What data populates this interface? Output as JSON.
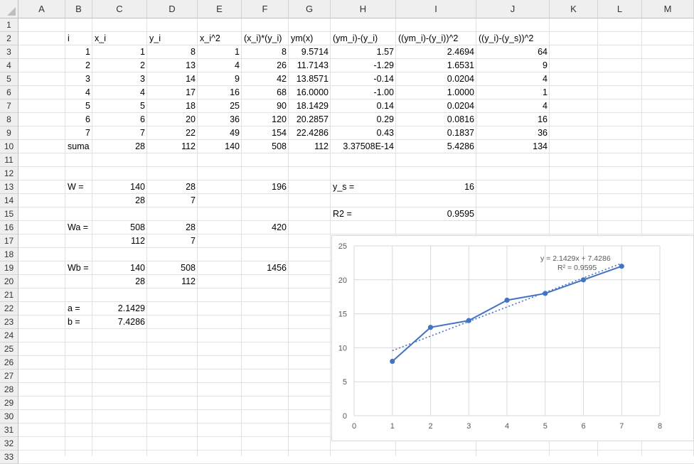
{
  "columns": [
    "A",
    "B",
    "C",
    "D",
    "E",
    "F",
    "G",
    "H",
    "I",
    "J",
    "K",
    "L",
    "M"
  ],
  "rows": [
    "1",
    "2",
    "3",
    "4",
    "5",
    "6",
    "7",
    "8",
    "9",
    "10",
    "11",
    "12",
    "13",
    "14",
    "15",
    "16",
    "17",
    "18",
    "19",
    "20",
    "21",
    "22",
    "23",
    "24",
    "25",
    "26",
    "27",
    "28",
    "29",
    "30",
    "31",
    "32",
    "33"
  ],
  "cells": [
    {
      "id": "B2",
      "v": "i",
      "a": "l"
    },
    {
      "id": "C2",
      "v": "x_i",
      "a": "l"
    },
    {
      "id": "D2",
      "v": "y_i",
      "a": "l"
    },
    {
      "id": "E2",
      "v": "x_i^2",
      "a": "l"
    },
    {
      "id": "F2",
      "v": "(x_i)*(y_i)",
      "a": "l"
    },
    {
      "id": "G2",
      "v": "ym(x)",
      "a": "l"
    },
    {
      "id": "H2",
      "v": "(ym_i)-(y_i)",
      "a": "l"
    },
    {
      "id": "I2",
      "v": "((ym_i)-(y_i))^2",
      "a": "l"
    },
    {
      "id": "J2",
      "v": "((y_i)-(y_s))^2",
      "a": "l"
    },
    {
      "id": "B3",
      "v": "1"
    },
    {
      "id": "C3",
      "v": "1"
    },
    {
      "id": "D3",
      "v": "8"
    },
    {
      "id": "E3",
      "v": "1"
    },
    {
      "id": "F3",
      "v": "8"
    },
    {
      "id": "G3",
      "v": "9.5714"
    },
    {
      "id": "H3",
      "v": "1.57"
    },
    {
      "id": "I3",
      "v": "2.4694"
    },
    {
      "id": "J3",
      "v": "64"
    },
    {
      "id": "B4",
      "v": "2"
    },
    {
      "id": "C4",
      "v": "2"
    },
    {
      "id": "D4",
      "v": "13"
    },
    {
      "id": "E4",
      "v": "4"
    },
    {
      "id": "F4",
      "v": "26"
    },
    {
      "id": "G4",
      "v": "11.7143"
    },
    {
      "id": "H4",
      "v": "-1.29"
    },
    {
      "id": "I4",
      "v": "1.6531"
    },
    {
      "id": "J4",
      "v": "9"
    },
    {
      "id": "B5",
      "v": "3"
    },
    {
      "id": "C5",
      "v": "3"
    },
    {
      "id": "D5",
      "v": "14"
    },
    {
      "id": "E5",
      "v": "9"
    },
    {
      "id": "F5",
      "v": "42"
    },
    {
      "id": "G5",
      "v": "13.8571"
    },
    {
      "id": "H5",
      "v": "-0.14"
    },
    {
      "id": "I5",
      "v": "0.0204"
    },
    {
      "id": "J5",
      "v": "4"
    },
    {
      "id": "B6",
      "v": "4"
    },
    {
      "id": "C6",
      "v": "4"
    },
    {
      "id": "D6",
      "v": "17"
    },
    {
      "id": "E6",
      "v": "16"
    },
    {
      "id": "F6",
      "v": "68"
    },
    {
      "id": "G6",
      "v": "16.0000"
    },
    {
      "id": "H6",
      "v": "-1.00"
    },
    {
      "id": "I6",
      "v": "1.0000"
    },
    {
      "id": "J6",
      "v": "1"
    },
    {
      "id": "B7",
      "v": "5"
    },
    {
      "id": "C7",
      "v": "5"
    },
    {
      "id": "D7",
      "v": "18"
    },
    {
      "id": "E7",
      "v": "25"
    },
    {
      "id": "F7",
      "v": "90"
    },
    {
      "id": "G7",
      "v": "18.1429"
    },
    {
      "id": "H7",
      "v": "0.14"
    },
    {
      "id": "I7",
      "v": "0.0204"
    },
    {
      "id": "J7",
      "v": "4"
    },
    {
      "id": "B8",
      "v": "6"
    },
    {
      "id": "C8",
      "v": "6"
    },
    {
      "id": "D8",
      "v": "20"
    },
    {
      "id": "E8",
      "v": "36"
    },
    {
      "id": "F8",
      "v": "120"
    },
    {
      "id": "G8",
      "v": "20.2857"
    },
    {
      "id": "H8",
      "v": "0.29"
    },
    {
      "id": "I8",
      "v": "0.0816"
    },
    {
      "id": "J8",
      "v": "16"
    },
    {
      "id": "B9",
      "v": "7"
    },
    {
      "id": "C9",
      "v": "7"
    },
    {
      "id": "D9",
      "v": "22"
    },
    {
      "id": "E9",
      "v": "49"
    },
    {
      "id": "F9",
      "v": "154"
    },
    {
      "id": "G9",
      "v": "22.4286"
    },
    {
      "id": "H9",
      "v": "0.43"
    },
    {
      "id": "I9",
      "v": "0.1837"
    },
    {
      "id": "J9",
      "v": "36"
    },
    {
      "id": "B10",
      "v": "suma",
      "a": "l"
    },
    {
      "id": "C10",
      "v": "28"
    },
    {
      "id": "D10",
      "v": "112"
    },
    {
      "id": "E10",
      "v": "140"
    },
    {
      "id": "F10",
      "v": "508"
    },
    {
      "id": "G10",
      "v": "112"
    },
    {
      "id": "H10",
      "v": "3.37508E-14"
    },
    {
      "id": "I10",
      "v": "5.4286"
    },
    {
      "id": "J10",
      "v": "134"
    },
    {
      "id": "B13",
      "v": "W =",
      "a": "l"
    },
    {
      "id": "C13",
      "v": "140"
    },
    {
      "id": "D13",
      "v": "28"
    },
    {
      "id": "F13",
      "v": "196"
    },
    {
      "id": "H13",
      "v": "y_s =",
      "a": "l"
    },
    {
      "id": "I13",
      "v": "16"
    },
    {
      "id": "C14",
      "v": "28"
    },
    {
      "id": "D14",
      "v": "7"
    },
    {
      "id": "H15",
      "v": "R2 =",
      "a": "l"
    },
    {
      "id": "I15",
      "v": "0.9595"
    },
    {
      "id": "B16",
      "v": "Wa =",
      "a": "l"
    },
    {
      "id": "C16",
      "v": "508"
    },
    {
      "id": "D16",
      "v": "28"
    },
    {
      "id": "F16",
      "v": "420"
    },
    {
      "id": "C17",
      "v": "112"
    },
    {
      "id": "D17",
      "v": "7"
    },
    {
      "id": "B19",
      "v": "Wb =",
      "a": "l"
    },
    {
      "id": "C19",
      "v": "140"
    },
    {
      "id": "D19",
      "v": "508"
    },
    {
      "id": "F19",
      "v": "1456"
    },
    {
      "id": "C20",
      "v": "28"
    },
    {
      "id": "D20",
      "v": "112"
    },
    {
      "id": "B22",
      "v": "a =",
      "a": "l"
    },
    {
      "id": "C22",
      "v": "2.1429"
    },
    {
      "id": "B23",
      "v": "b =",
      "a": "l"
    },
    {
      "id": "C23",
      "v": "7.4286"
    }
  ],
  "chart_data": {
    "type": "scatter",
    "x": [
      1,
      2,
      3,
      4,
      5,
      6,
      7
    ],
    "y": [
      8,
      13,
      14,
      17,
      18,
      20,
      22
    ],
    "xlim": [
      0,
      8
    ],
    "ylim": [
      0,
      25
    ],
    "xticks": [
      "0",
      "1",
      "2",
      "3",
      "4",
      "5",
      "6",
      "7",
      "8"
    ],
    "yticks": [
      "0",
      "5",
      "10",
      "15",
      "20",
      "25"
    ],
    "grid": true,
    "series_color": "#4472c4",
    "trendline": {
      "slope": 2.1429,
      "intercept": 7.4286,
      "equation": "y = 2.1429x + 7.4286",
      "r2_label": "R² = 0.9595"
    }
  }
}
